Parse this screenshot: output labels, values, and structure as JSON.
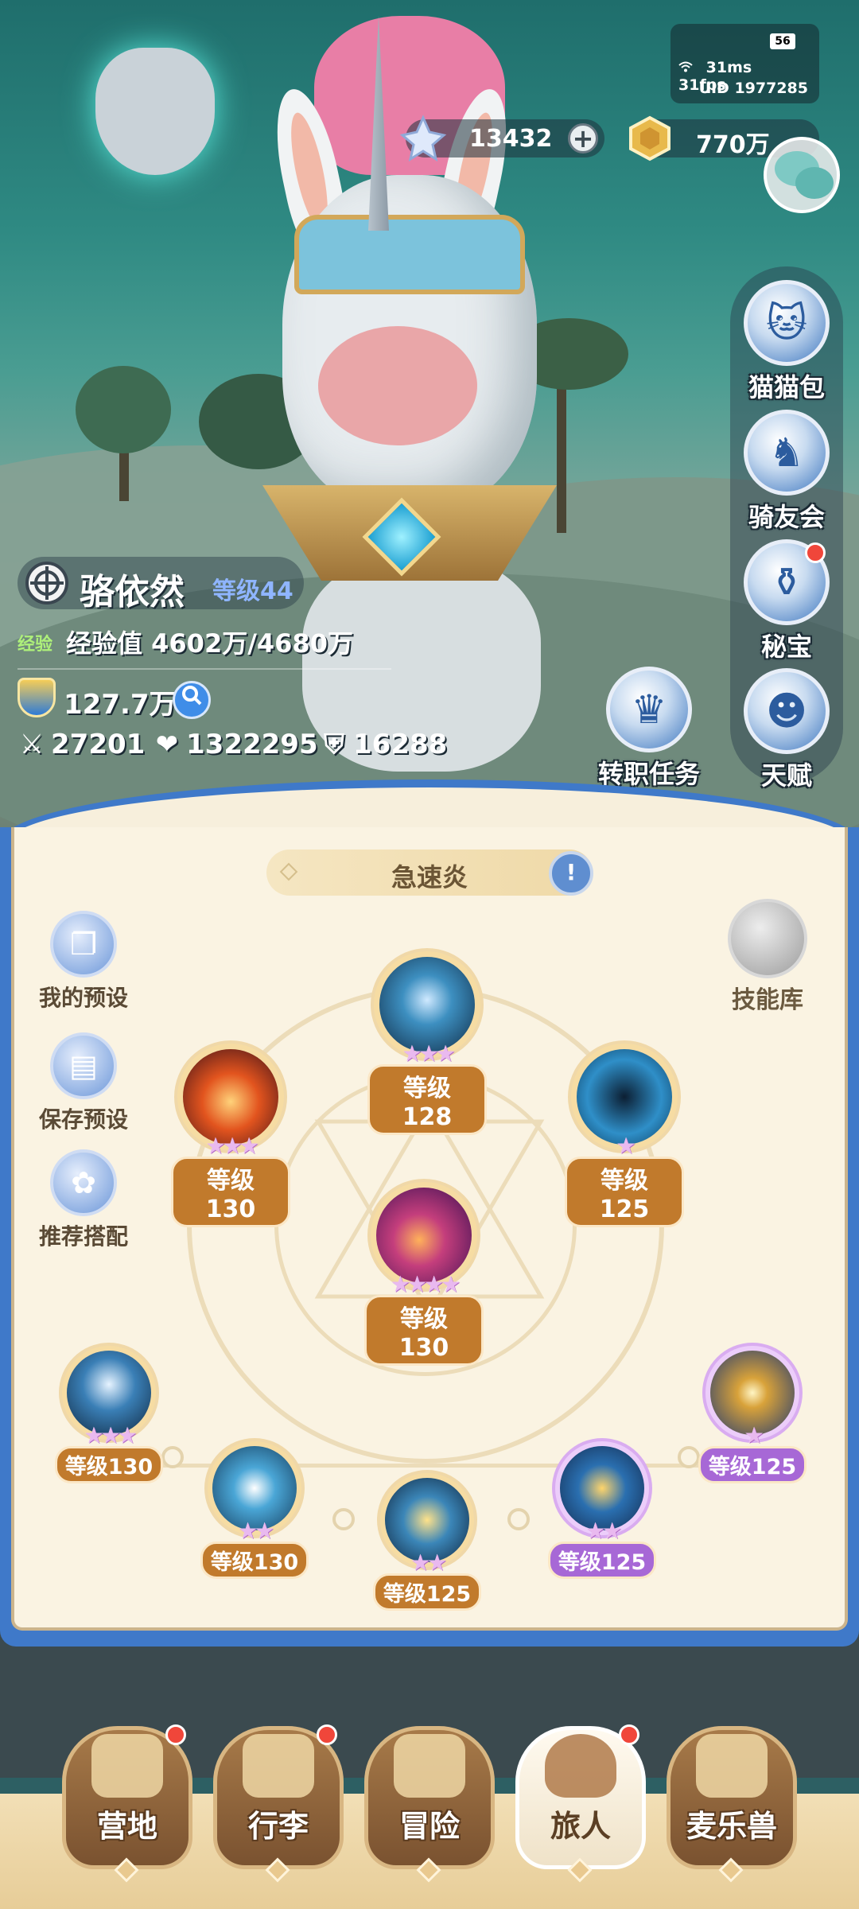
{
  "status": {
    "battery": "56",
    "ping": "31ms",
    "fps": "31fps",
    "uid": "UID 1977285"
  },
  "currency": {
    "gems": "13432",
    "gold": "770万"
  },
  "side_menu": [
    {
      "label": "猫猫包",
      "badge": false
    },
    {
      "label": "骑友会",
      "badge": false
    },
    {
      "label": "秘宝",
      "badge": true
    },
    {
      "label": "天赋",
      "badge": false
    }
  ],
  "player": {
    "name": "骆依然",
    "level": "等级44",
    "exp_tag": "经验",
    "exp_text": "经验值 4602万/4680万",
    "power": "127.7万",
    "attack": "27201",
    "hp": "1322295",
    "defense": "16288"
  },
  "mid_buttons": {
    "job_change": "转职任务"
  },
  "skill_panel": {
    "title": "急速炎",
    "info_icon": "!",
    "left_buttons": [
      "我的预设",
      "保存预设",
      "推荐搭配"
    ],
    "skill_library": "技能库",
    "skills": [
      {
        "level": "等级128",
        "stars": "★★★",
        "color": "#2a6a8a",
        "rarity": "gold"
      },
      {
        "level": "等级130",
        "stars": "★★★",
        "color": "#b8431d",
        "rarity": "gold"
      },
      {
        "level": "等级125",
        "stars": "★",
        "color": "#1d6f9a",
        "rarity": "gold"
      },
      {
        "level": "等级130",
        "stars": "★★★★",
        "color": "#7a2aa0",
        "rarity": "gold"
      },
      {
        "level": "等级130",
        "stars": "★★★",
        "color": "#1b5c8e",
        "rarity": "gold"
      },
      {
        "level": "等级130",
        "stars": "★★",
        "color": "#2a6da0",
        "rarity": "gold"
      },
      {
        "level": "等级125",
        "stars": "★★",
        "color": "#2e5f86",
        "rarity": "gold"
      },
      {
        "level": "等级125",
        "stars": "★★",
        "color": "#2b4f8a",
        "rarity": "purple"
      },
      {
        "level": "等级125",
        "stars": "★",
        "color": "#3b4a86",
        "rarity": "purple"
      }
    ]
  },
  "nav": [
    {
      "label": "营地",
      "badge": true,
      "active": false
    },
    {
      "label": "行李",
      "badge": true,
      "active": false
    },
    {
      "label": "冒险",
      "badge": false,
      "active": false
    },
    {
      "label": "旅人",
      "badge": true,
      "active": true
    },
    {
      "label": "麦乐兽",
      "badge": false,
      "active": false
    }
  ]
}
